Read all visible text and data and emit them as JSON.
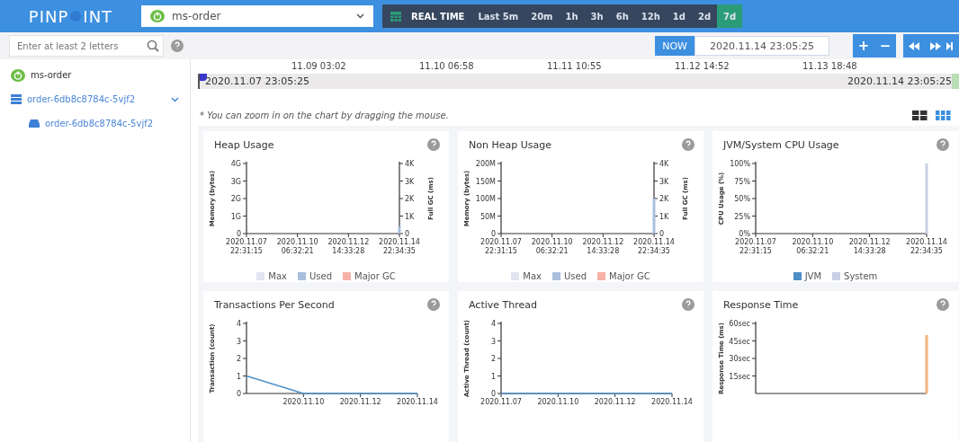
{
  "header": {
    "logo": {
      "left": "PINP",
      "right": "INT"
    },
    "app_selector": {
      "value": "ms-order"
    },
    "realtime_label": "REAL TIME",
    "time_ranges": [
      {
        "label": "Last 5m",
        "selected": false
      },
      {
        "label": "20m",
        "selected": false
      },
      {
        "label": "1h",
        "selected": false
      },
      {
        "label": "3h",
        "selected": false
      },
      {
        "label": "6h",
        "selected": false
      },
      {
        "label": "12h",
        "selected": false
      },
      {
        "label": "1d",
        "selected": false
      },
      {
        "label": "2d",
        "selected": false
      },
      {
        "label": "7d",
        "selected": true
      }
    ]
  },
  "search": {
    "placeholder": "Enter at least 2 letters"
  },
  "time_controls": {
    "now_label": "NOW",
    "date_value": "2020.11.14 23:05:25",
    "zoom_buttons": [
      "+",
      "−"
    ]
  },
  "sidebar": {
    "items": [
      {
        "label": "ms-order",
        "kind": "application"
      },
      {
        "label": "order-6db8c8784c-5vjf2",
        "kind": "host",
        "expanded": true,
        "children": [
          {
            "label": "order-6db8c8784c-5vjf2",
            "kind": "agent"
          }
        ]
      }
    ]
  },
  "timeline": {
    "labels": [
      "11.09 03:02",
      "11.10 06:58",
      "11.11 10:55",
      "11.12 14:52",
      "11.13 18:48"
    ],
    "start": "2020.11.07 23:05:25",
    "end": "2020.11.14 23:05:25"
  },
  "note": "* You can zoom in on the chart by dragging the mouse.",
  "view_options": [
    {
      "kind": "two-column",
      "selected": false
    },
    {
      "kind": "three-column",
      "selected": true
    }
  ],
  "charts": [
    {
      "title": "Heap Usage",
      "chart_data": {
        "type": "bar",
        "ylim": [
          0,
          4
        ],
        "y2lim": [
          0,
          4
        ],
        "ylabel": "Memory (bytes)",
        "y2label": "Full GC (ms)",
        "yticks": [
          {
            "value": 0,
            "label": "0"
          },
          {
            "value": 1,
            "label": "1G"
          },
          {
            "value": 2,
            "label": "2G"
          },
          {
            "value": 3,
            "label": "3G"
          },
          {
            "value": 4,
            "label": "4G"
          }
        ],
        "y2ticks": [
          {
            "value": 0,
            "label": "0"
          },
          {
            "value": 1,
            "label": "1K"
          },
          {
            "value": 2,
            "label": "2K"
          },
          {
            "value": 3,
            "label": "3K"
          },
          {
            "value": 4,
            "label": "4K"
          }
        ],
        "categories": [
          "2020.11.07 22:31:15",
          "2020.11.10 06:32:21",
          "2020.11.12 14:33:28",
          "2020.11.14 22:34:35"
        ],
        "series": [
          {
            "name": "Max",
            "color": "#e3e4f1",
            "values": [
              null,
              null,
              null,
              null
            ]
          },
          {
            "name": "Used",
            "color": "#a9bfdc",
            "values": [
              null,
              null,
              null,
              0.4
            ]
          },
          {
            "name": "Major GC",
            "color": "#f7b3a8",
            "values": [
              null,
              null,
              null,
              null
            ]
          }
        ]
      }
    },
    {
      "title": "Non Heap Usage",
      "chart_data": {
        "type": "bar",
        "ylim": [
          0,
          200
        ],
        "y2lim": [
          0,
          4
        ],
        "ylabel": "Memory (bytes)",
        "y2label": "Full GC (ms)",
        "yticks": [
          {
            "value": 0,
            "label": "0"
          },
          {
            "value": 50,
            "label": "50M"
          },
          {
            "value": 100,
            "label": "100M"
          },
          {
            "value": 150,
            "label": "150M"
          },
          {
            "value": 200,
            "label": "200M"
          }
        ],
        "y2ticks": [
          {
            "value": 0,
            "label": "0"
          },
          {
            "value": 1,
            "label": "1K"
          },
          {
            "value": 2,
            "label": "2K"
          },
          {
            "value": 3,
            "label": "3K"
          },
          {
            "value": 4,
            "label": "4K"
          }
        ],
        "categories": [
          "2020.11.07 22:31:15",
          "2020.11.10 06:32:21",
          "2020.11.12 14:33:28",
          "2020.11.14 22:34:35"
        ],
        "series": [
          {
            "name": "Max",
            "color": "#e3e4f1",
            "values": [
              null,
              null,
              null,
              null
            ]
          },
          {
            "name": "Used",
            "color": "#a9bfdc",
            "values": [
              null,
              null,
              null,
              100
            ]
          },
          {
            "name": "Major GC",
            "color": "#f7b3a8",
            "values": [
              null,
              null,
              null,
              null
            ]
          }
        ]
      }
    },
    {
      "title": "JVM/System CPU Usage",
      "chart_data": {
        "type": "bar",
        "ylim": [
          0,
          100
        ],
        "ylabel": "CPU Usage (%)",
        "yticks": [
          {
            "value": 0,
            "label": "0%"
          },
          {
            "value": 25,
            "label": "25%"
          },
          {
            "value": 50,
            "label": "50%"
          },
          {
            "value": 75,
            "label": "75%"
          },
          {
            "value": 100,
            "label": "100%"
          }
        ],
        "categories": [
          "2020.11.07 22:31:15",
          "2020.11.10 06:32:21",
          "2020.11.12 14:33:28",
          "2020.11.14 22:34:35"
        ],
        "series": [
          {
            "name": "JVM",
            "color": "#4e8fc7",
            "values": [
              null,
              null,
              null,
              null
            ]
          },
          {
            "name": "System",
            "color": "#c9cfe6",
            "values": [
              null,
              null,
              null,
              100
            ]
          }
        ]
      }
    },
    {
      "title": "Transactions Per Second",
      "chart_data": {
        "type": "line",
        "ylim": [
          0,
          4
        ],
        "ylabel": "Transaction (count)",
        "yticks": [
          {
            "value": 0,
            "label": "0"
          },
          {
            "value": 1,
            "label": "1"
          },
          {
            "value": 2,
            "label": "2"
          },
          {
            "value": 3,
            "label": "3"
          },
          {
            "value": 4,
            "label": "4"
          }
        ],
        "categories": [
          null,
          "2020.11.10",
          "2020.11.12",
          "2020.11.14"
        ],
        "series": [
          {
            "color": "#4e8fc7",
            "values": [
              1,
              0,
              0,
              0
            ]
          }
        ]
      }
    },
    {
      "title": "Active Thread",
      "chart_data": {
        "type": "line",
        "ylim": [
          0,
          4
        ],
        "ylabel": "Active Thread (count)",
        "yticks": [
          {
            "value": 0,
            "label": "0"
          },
          {
            "value": 1,
            "label": "1"
          },
          {
            "value": 2,
            "label": "2"
          },
          {
            "value": 3,
            "label": "3"
          },
          {
            "value": 4,
            "label": "4"
          }
        ],
        "categories": [
          "2020.11.07",
          "2020.11.10",
          "2020.11.12",
          "2020.11.14"
        ],
        "series": [
          {
            "color": "#4e8fc7",
            "values": [
              0,
              0,
              0,
              0
            ]
          }
        ]
      }
    },
    {
      "title": "Response Time",
      "chart_data": {
        "type": "bar",
        "ylim": [
          0,
          60
        ],
        "ylabel": "Response Time (ms)",
        "yticks": [
          {
            "value": 15,
            "label": "15sec"
          },
          {
            "value": 30,
            "label": "30sec"
          },
          {
            "value": 45,
            "label": "45sec"
          },
          {
            "value": 60,
            "label": "60sec"
          }
        ],
        "categories": [
          null,
          null,
          null,
          null
        ],
        "series": [
          {
            "color": "#f5b27a",
            "values": [
              null,
              null,
              null,
              50
            ]
          }
        ]
      }
    }
  ]
}
